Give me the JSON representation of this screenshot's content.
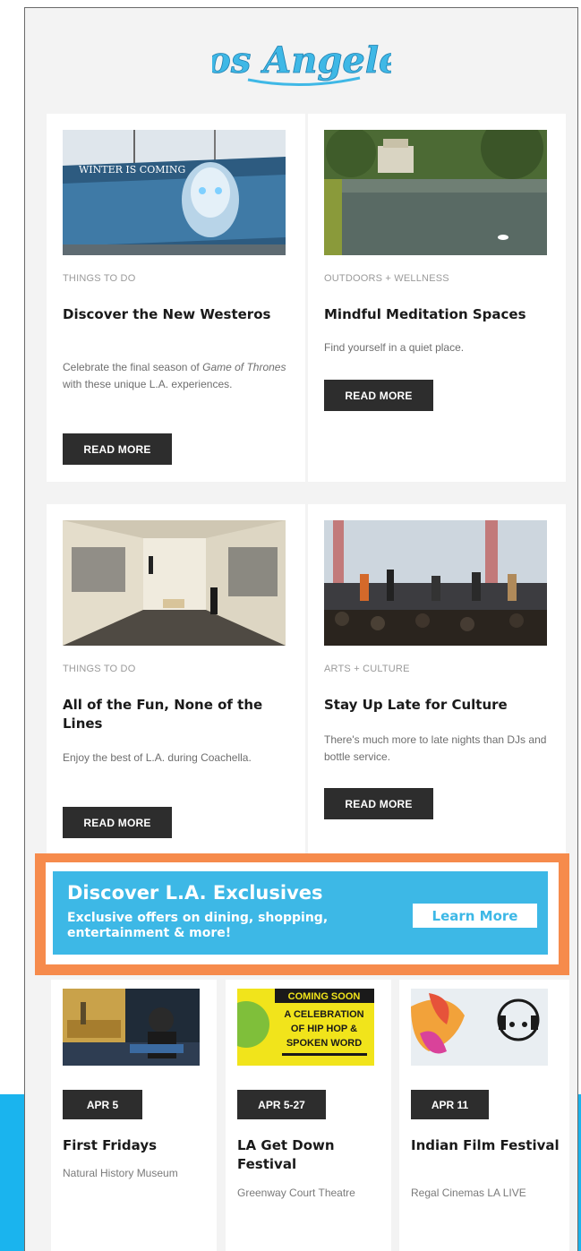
{
  "logo": {
    "text": "Los Angeles",
    "color": "#3fb8e6"
  },
  "articles": [
    {
      "category": "THINGS TO DO",
      "title": "Discover the New Westeros",
      "desc_parts": [
        "Celebrate the final season of ",
        "Game of Thrones",
        " with these unique L.A. experiences."
      ],
      "button": "READ MORE",
      "image": "game-of-thrones-mural-image",
      "image_text": "WINTER IS COMING"
    },
    {
      "category": "OUTDOORS + WELLNESS",
      "title": "Mindful Meditation Spaces",
      "desc": "Find yourself in a quiet place.",
      "button": "READ MORE",
      "image": "lake-shrine-image"
    },
    {
      "category": "THINGS TO DO",
      "title": "All of the Fun, None of the Lines",
      "desc": "Enjoy the best of L.A. during Coachella.",
      "button": "READ MORE",
      "image": "photo-gallery-image"
    },
    {
      "category": "ARTS + CULTURE",
      "title": "Stay Up Late for Culture",
      "desc": "There's much more to late nights than DJs and bottle service.",
      "button": "READ MORE",
      "image": "concert-image"
    }
  ],
  "promo": {
    "headline": "Discover L.A. Exclusives",
    "subtext": "Exclusive offers on dining, shopping, entertainment & more!",
    "button": "Learn More",
    "colors": {
      "banner": "#3db8e6",
      "border": "#f68b4c"
    }
  },
  "events": [
    {
      "date": "APR 5",
      "title": "First Fridays",
      "venue": "Natural History Museum",
      "image": "dj-museum-image"
    },
    {
      "date": "APR 5-27",
      "title": "LA Get Down Festival",
      "venue": "Greenway Court Theatre",
      "image": "hip-hop-poster-image",
      "poster_lines": [
        "COMING SOON",
        "A CELEBRATION",
        "OF HIP HOP &",
        "SPOKEN WORD"
      ]
    },
    {
      "date": "APR 11",
      "title": "Indian Film Festival",
      "venue": "Regal Cinemas LA LIVE",
      "image": "film-festival-art-image"
    }
  ]
}
